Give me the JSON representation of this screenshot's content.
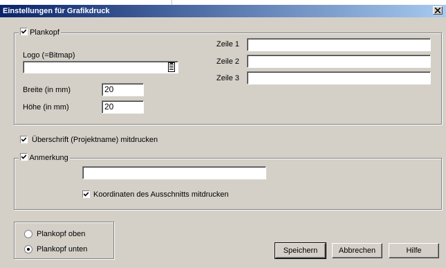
{
  "window": {
    "title": "Einstellungen für Grafikdruck"
  },
  "plankopf": {
    "label": "Plankopf",
    "checked": true,
    "logo_label": "Logo (=Bitmap)",
    "logo_value": "",
    "breite_label": "Breite (in mm)",
    "breite_value": "20",
    "hoehe_label": "Höhe (in mm)",
    "hoehe_value": "20",
    "zeilen": [
      {
        "label": "Zeile 1",
        "value": ""
      },
      {
        "label": "Zeile 2",
        "value": ""
      },
      {
        "label": "Zeile 3",
        "value": ""
      }
    ]
  },
  "ueberschrift": {
    "label": "Überschrift (Projektname) mitdrucken",
    "checked": true
  },
  "anmerkung": {
    "label": "Anmerkung",
    "checked": true,
    "value": "",
    "koordinaten_label": "Koordinaten des Ausschnitts mitdrucken",
    "koordinaten_checked": true
  },
  "position": {
    "options": [
      "Plankopf oben",
      "Plankopf unten"
    ],
    "selected": "Plankopf unten"
  },
  "buttons": {
    "save": "Speichern",
    "cancel": "Abbrechen",
    "help": "Hilfe"
  }
}
